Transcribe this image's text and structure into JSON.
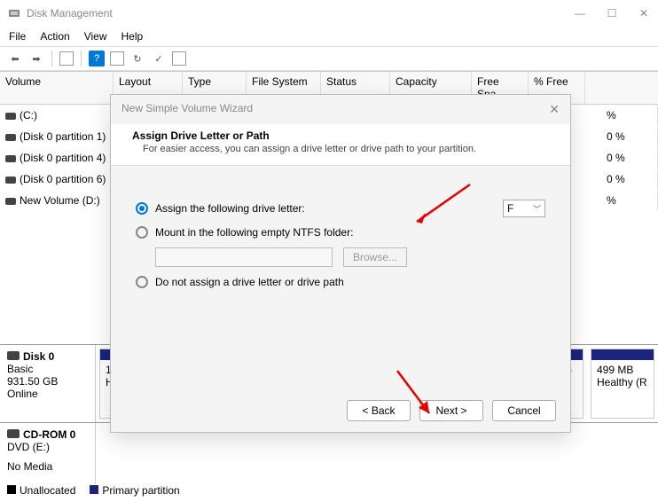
{
  "window": {
    "title": "Disk Management"
  },
  "menu": {
    "file": "File",
    "action": "Action",
    "view": "View",
    "help": "Help"
  },
  "grid": {
    "headers": {
      "volume": "Volume",
      "layout": "Layout",
      "type": "Type",
      "fs": "File System",
      "status": "Status",
      "capacity": "Capacity",
      "free": "Free Spa...",
      "pct": "% Free"
    },
    "rows": [
      {
        "name": "(C:)",
        "pct": "%"
      },
      {
        "name": "(Disk 0 partition 1)",
        "pct": "0 %"
      },
      {
        "name": "(Disk 0 partition 4)",
        "pct": "0 %"
      },
      {
        "name": "(Disk 0 partition 6)",
        "pct": "0 %"
      },
      {
        "name": "New Volume (D:)",
        "pct": "%"
      }
    ]
  },
  "disk0": {
    "title": "Disk 0",
    "type": "Basic",
    "size": "931.50 GB",
    "status": "Online"
  },
  "part_left": {
    "line1": "1(",
    "line2": "H"
  },
  "part_mid": {
    "line1": "C:)",
    "line2": "ta Pa"
  },
  "part_right": {
    "line1": "499 MB",
    "line2": "Healthy (R"
  },
  "cdrom": {
    "title": "CD-ROM 0",
    "drive": "DVD (E:)",
    "status": "No Media"
  },
  "legend": {
    "unalloc": "Unallocated",
    "primary": "Primary partition"
  },
  "dialog": {
    "title": "New Simple Volume Wizard",
    "heading": "Assign Drive Letter or Path",
    "sub": "For easier access, you can assign a drive letter or drive path to your partition.",
    "opt1": "Assign the following drive letter:",
    "drive": "F",
    "opt2": "Mount in the following empty NTFS folder:",
    "browse": "Browse...",
    "opt3": "Do not assign a drive letter or drive path",
    "back": "< Back",
    "next": "Next >",
    "cancel": "Cancel"
  }
}
